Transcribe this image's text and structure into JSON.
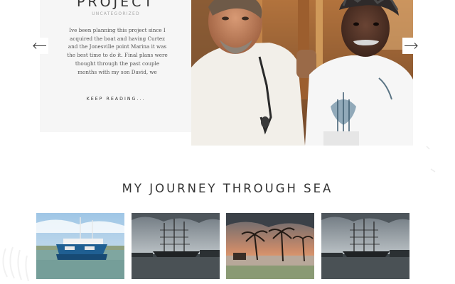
{
  "hero": {
    "post": {
      "title": "PROJECT",
      "category": "UNCATEGORIZED",
      "excerpt": "Ive been planning this project since I acquired the boat and having Curtez and the Jonesville point Marina it was the best time to do it. Final plans were thought through the past couple months with my son David, we",
      "read_more": "KEEP READING..."
    },
    "prev_icon": "arrow-left-icon",
    "next_icon": "arrow-right-icon"
  },
  "gallery": {
    "title": "MY JOURNEY THROUGH SEA",
    "items": [
      {
        "subject": "catamaran-at-marina"
      },
      {
        "subject": "tall-ship-at-dock"
      },
      {
        "subject": "palm-trees-sunset"
      },
      {
        "subject": "tall-ship-at-dock"
      }
    ]
  }
}
